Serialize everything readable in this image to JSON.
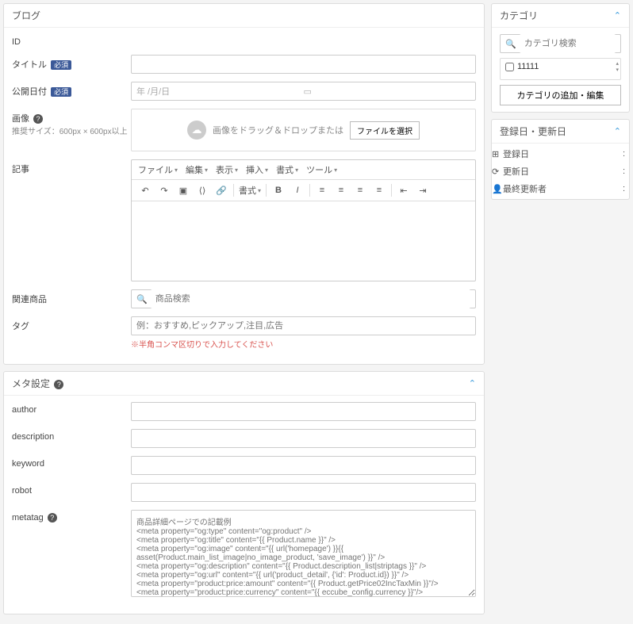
{
  "blog": {
    "title": "ブログ",
    "labels": {
      "id": "ID",
      "title": "タイトル",
      "publish_date": "公開日付",
      "image": "画像",
      "image_hint": "推奨サイズ：600px × 600px以上",
      "article": "記事",
      "related": "関連商品",
      "tag": "タグ",
      "required": "必須"
    },
    "date_placeholder": "年 /月/日",
    "dropzone_text": "画像をドラッグ＆ドロップまたは",
    "file_select": "ファイルを選択",
    "product_search_placeholder": "商品検索",
    "tag_placeholder": "例：おすすめ,ピックアップ,注目,広告",
    "tag_hint": "※半角コンマ区切りで入力してください"
  },
  "editor": {
    "menus": {
      "file": "ファイル",
      "edit": "編集",
      "view": "表示",
      "insert": "挿入",
      "format": "書式",
      "tools": "ツール"
    },
    "format_label": "書式"
  },
  "meta": {
    "title": "メタ設定",
    "labels": {
      "author": "author",
      "description": "description",
      "keyword": "keyword",
      "robot": "robot",
      "metatag": "metatag"
    },
    "metatag_placeholder": "商品詳細ページでの記載例\n<meta property=\"og:type\" content=\"og:product\" />\n<meta property=\"og:title\" content=\"{{ Product.name }}\" />\n<meta property=\"og:image\" content=\"{{ url('homepage') }}{{ asset(Product.main_list_image|no_image_product, 'save_image') }}\" />\n<meta property=\"og:description\" content=\"{{ Product.description_list|striptags }}\" />\n<meta property=\"og:url\" content=\"{{ url('product_detail', {'id': Product.id}) }}\" />\n<meta property=\"product:price:amount\" content=\"{{ Product.getPrice02IncTaxMin }}\"/>\n<meta property=\"product:price:currency\" content=\"{{ eccube_config.currency }}\"/>\n<meta property=\"product:product_link\" content=\"{{ url('product_detail', {'id': Product.id})}}\"/>\n<meta property=\"product:retailer_title\" content=\"{{ BaseInfo.shop_name }}\"/>"
  },
  "category": {
    "title": "カテゴリ",
    "search_placeholder": "カテゴリ検索",
    "items": [
      {
        "label": "11111",
        "checked": false
      }
    ],
    "edit_button": "カテゴリの追加・編集"
  },
  "dates": {
    "title": "登録日・更新日",
    "rows": {
      "created": {
        "label": "登録日",
        "value": ":"
      },
      "updated": {
        "label": "更新日",
        "value": ":"
      },
      "updater": {
        "label": "最終更新者",
        "value": ":"
      }
    }
  }
}
